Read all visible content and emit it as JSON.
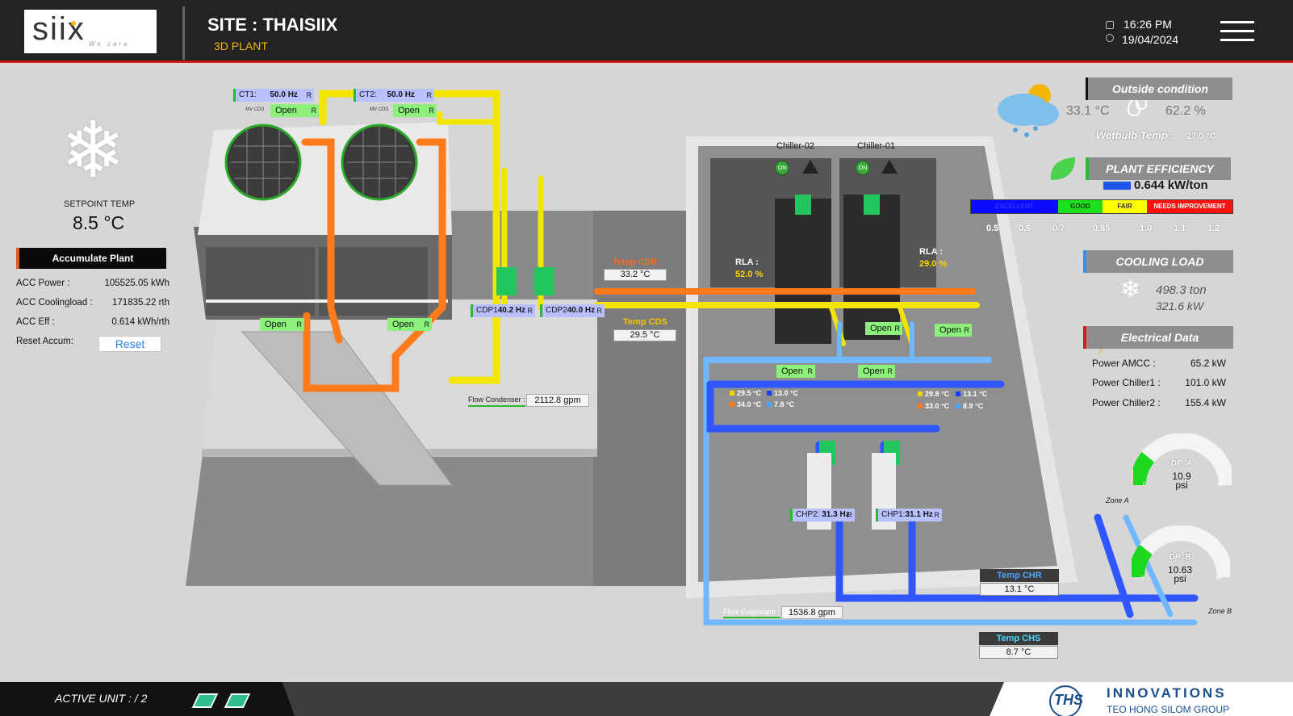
{
  "header": {
    "logo": "siix",
    "logo_tag": "We care",
    "site": "SITE : THAISIIX",
    "subtitle": "3D PLANT",
    "time": "16:26 PM",
    "date": "19/04/2024"
  },
  "left": {
    "setpoint_label": "SETPOINT TEMP",
    "setpoint_value": "8.5 °C",
    "acc_title": "Accumulate Plant",
    "rows": [
      {
        "label": "ACC Power :",
        "value": "105525.05 kWh"
      },
      {
        "label": "ACC Coolingload :",
        "value": "171835.22 rth"
      },
      {
        "label": "ACC Eff :",
        "value": "0.614 kWh/rth"
      }
    ],
    "reset_label": "Reset Accum:",
    "reset_button": "Reset"
  },
  "outside": {
    "title": "Outside condition",
    "temp": "33.1 °C",
    "humidity": "62.2 %",
    "wetbulb_label": "Wetbulb Temp :",
    "wetbulb_value": "27.0 °C"
  },
  "efficiency": {
    "title": "PLANT EFFICIENCY",
    "value": "0.644 kW/ton",
    "scale": [
      {
        "label": "EXCELLENT",
        "color": "#0b0bff",
        "text": "#1a1aff"
      },
      {
        "label": "GOOD",
        "color": "#1be01b",
        "text": "#0a3a0a"
      },
      {
        "label": "FAIR",
        "color": "#ffff00",
        "text": "#333"
      },
      {
        "label": "NEEDS IMPROVEMENT",
        "color": "#ff1010",
        "text": "#fff"
      }
    ],
    "ticks": [
      "0.5",
      "0.6",
      "0.7",
      "0.85",
      "1.0",
      "1.1",
      "1.2"
    ]
  },
  "cooling": {
    "title": "COOLING LOAD",
    "ton": "498.3 ton",
    "kw": "321.6 kW"
  },
  "electrical": {
    "title": "Electrical Data",
    "rows": [
      {
        "label": "Power AMCC :",
        "value": "65.2 kW"
      },
      {
        "label": "Power Chiller1 :",
        "value": "101.0 kW"
      },
      {
        "label": "Power Chiller2 :",
        "value": "155.4 kW"
      }
    ]
  },
  "gauges": [
    {
      "name": "DP_A",
      "value": "10.9",
      "unit": "psi",
      "min": "0",
      "max": "50",
      "zone": "Zone A",
      "level": 0.218
    },
    {
      "name": "DP_B",
      "value": "10.63",
      "unit": "psi",
      "min": "0",
      "max": "50",
      "zone": "Zone B",
      "level": 0.213
    }
  ],
  "plant": {
    "ct1": {
      "label": "CT1:",
      "hz": "50.0 Hz",
      "r": "R",
      "mv": "MV CDS",
      "open": "Open"
    },
    "ct2": {
      "label": "CT2:",
      "hz": "50.0 Hz",
      "r": "R",
      "mv": "MV CDS",
      "open": "Open"
    },
    "ct_bottom_open": [
      "Open",
      "Open"
    ],
    "cdp1": {
      "label": "CDP1",
      "hz": "40.2 Hz",
      "r": "R"
    },
    "cdp2": {
      "label": "CDP2",
      "hz": "40.0 Hz",
      "r": "R"
    },
    "temp_cdr": {
      "title": "Temp CDR",
      "value": "33.2 °C"
    },
    "temp_cds": {
      "title": "Temp CDS",
      "value": "29.5 °C"
    },
    "flow_condenser": {
      "label": "Flow Condenser :",
      "value": "2112.8 gpm"
    },
    "chiller2": {
      "name": "Chiller-02",
      "on": "ON",
      "rla_label": "RLA :",
      "rla": "52.0 %"
    },
    "chiller1": {
      "name": "Chiller-01",
      "on": "ON",
      "rla_label": "RLA :",
      "rla": "29.0 %"
    },
    "chiller_opens": [
      "Open",
      "Open",
      "Open",
      "Open"
    ],
    "ch2_temps": [
      {
        "color": "#f2d200",
        "val": "29.5 °C"
      },
      {
        "color": "#1a3cff",
        "val": "13.0 °C"
      },
      {
        "color": "#ff7a1a",
        "val": "34.0 °C"
      },
      {
        "color": "#4fa3ff",
        "val": "7.8 °C"
      }
    ],
    "ch1_temps": [
      {
        "color": "#f2d200",
        "val": "29.8 °C"
      },
      {
        "color": "#1a3cff",
        "val": "13.1 °C"
      },
      {
        "color": "#ff7a1a",
        "val": "33.0 °C"
      },
      {
        "color": "#4fa3ff",
        "val": "8.9 °C"
      }
    ],
    "chp2": {
      "label": "CHP2:",
      "hz": "31.3 Hz",
      "r": "R"
    },
    "chp1": {
      "label": "CHP1:",
      "hz": "31.1 Hz",
      "r": "R"
    },
    "flow_evaporator": {
      "label": "Flow Evaporator :",
      "value": "1536.8 gpm"
    },
    "temp_chr": {
      "title": "Temp CHR",
      "value": "13.1 °C"
    },
    "temp_chs": {
      "title": "Temp CHS",
      "value": "8.7 °C"
    }
  },
  "footer": {
    "active_unit": "ACTIVE UNIT : / 2",
    "ths": "THS",
    "brand": "INNOVATIONS",
    "group": "TEO HONG SILOM GROUP"
  }
}
